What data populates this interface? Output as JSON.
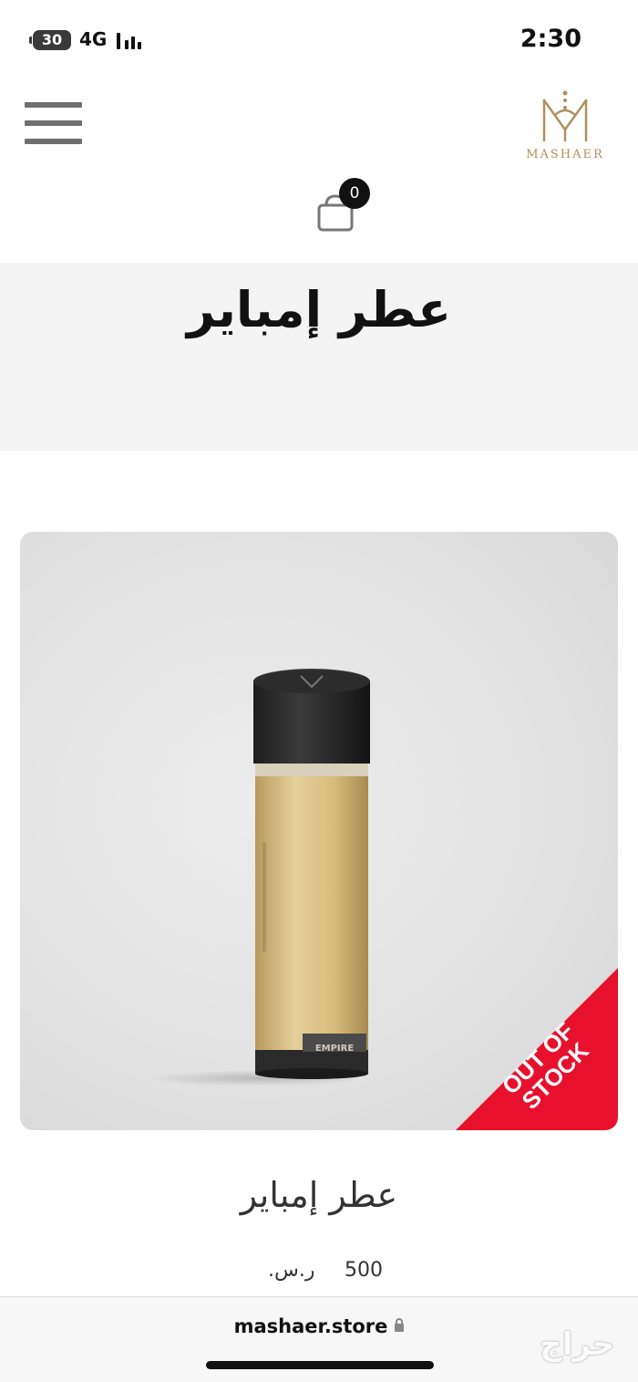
{
  "status_bar": {
    "battery": "30",
    "network": "4G",
    "time": "2:30"
  },
  "header": {
    "menu_icon": "hamburger-menu-icon",
    "logo_text": "MASHAER",
    "brand_color": "#b08f5e"
  },
  "cart": {
    "icon": "shopping-bag-icon",
    "count": "0"
  },
  "page": {
    "title": "عطر إمباير"
  },
  "product": {
    "image_icon": "perfume-bottle-image",
    "bottle_label": "EMPIRE",
    "badge": "OUT OF STOCK",
    "badge_color": "#e8112d",
    "name": "عطر إمباير",
    "price": "500",
    "currency": "ر.س."
  },
  "browser": {
    "url": "mashaer.store",
    "lock_icon": "lock-icon",
    "watermark": "حراج"
  }
}
